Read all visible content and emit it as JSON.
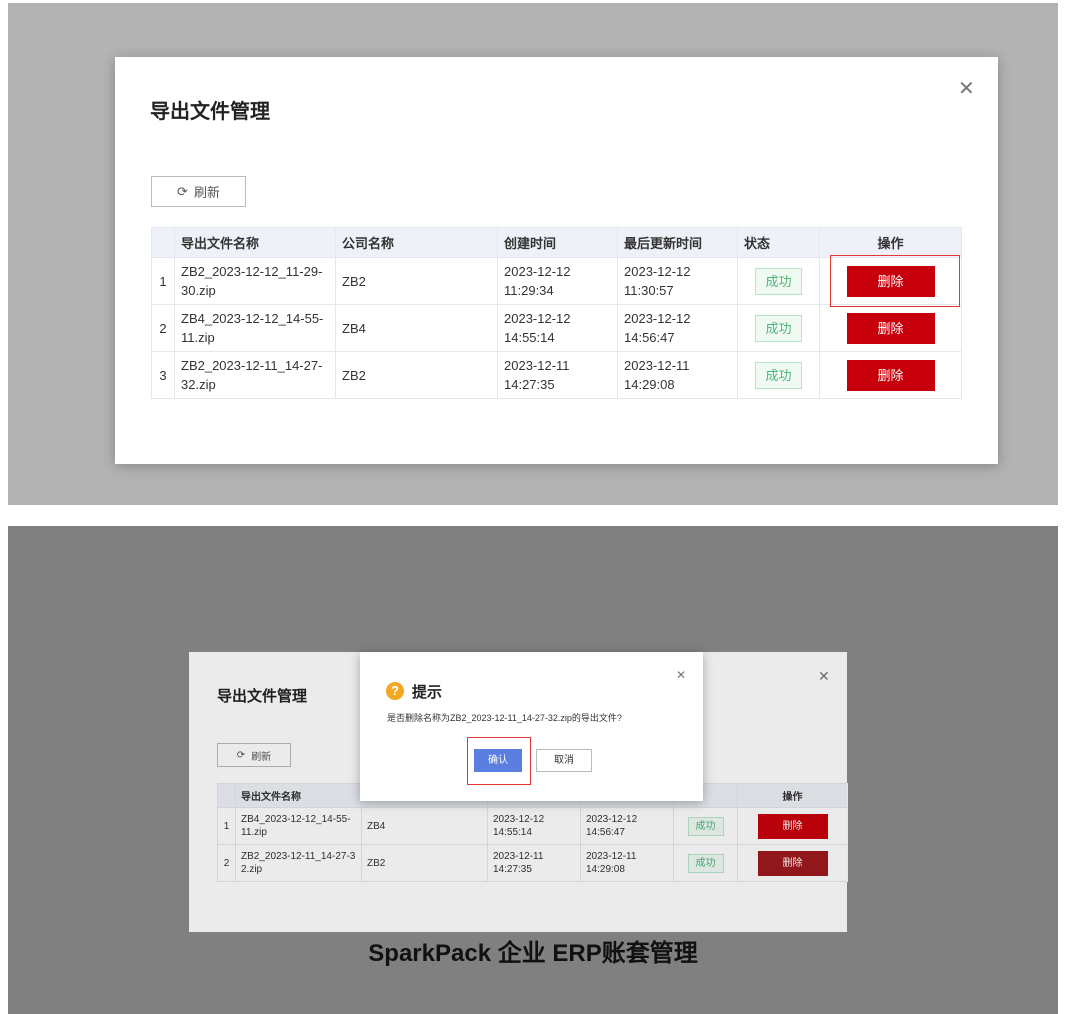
{
  "modal_title": "导出文件管理",
  "close_icon": "close-icon",
  "refresh_label": "刷新",
  "refresh_icon": "refresh-icon",
  "columns": [
    "导出文件名称",
    "公司名称",
    "创建时间",
    "最后更新时间",
    "状态",
    "操作"
  ],
  "rows": [
    {
      "index": "1",
      "file_name": "ZB2_2023-12-12_11-29-30.zip",
      "company": "ZB2",
      "created": "2023-12-12 11:29:34",
      "updated": "2023-12-12 11:30:57",
      "status": "成功",
      "action": "删除"
    },
    {
      "index": "2",
      "file_name": "ZB4_2023-12-12_14-55-11.zip",
      "company": "ZB4",
      "created": "2023-12-12 14:55:14",
      "updated": "2023-12-12 14:56:47",
      "status": "成功",
      "action": "删除"
    },
    {
      "index": "3",
      "file_name": "ZB2_2023-12-11_14-27-32.zip",
      "company": "ZB2",
      "created": "2023-12-11 14:27:35",
      "updated": "2023-12-11 14:29:08",
      "status": "成功",
      "action": "删除"
    }
  ],
  "second_view": {
    "header_visible": [
      "导出文件名称",
      "态",
      "操作"
    ],
    "rows": [
      {
        "index": "1",
        "file_name": "ZB4_2023-12-12_14-55-11.zip",
        "company": "ZB4",
        "created": "2023-12-12 14:55:14",
        "updated": "2023-12-12 14:56:47",
        "status": "成功",
        "action": "删除"
      },
      {
        "index": "2",
        "file_name": "ZB2_2023-12-11_14-27-32.zip",
        "company": "ZB2",
        "created": "2023-12-11 14:27:35",
        "updated": "2023-12-11 14:29:08",
        "status": "成功",
        "action": "删除"
      }
    ]
  },
  "confirm_dialog": {
    "title": "提示",
    "message": "是否删除名称为ZB2_2023-12-11_14-27-32.zip的导出文件?",
    "confirm_label": "确认",
    "cancel_label": "取消",
    "icon": "question-icon"
  },
  "caption": "SparkPack 企业 ERP账套管理",
  "colors": {
    "delete_button": "#c8000b",
    "confirm_button": "#5b7fe0",
    "success_text": "#4bb679",
    "highlight": "#e53935",
    "question_icon": "#f5a623"
  }
}
